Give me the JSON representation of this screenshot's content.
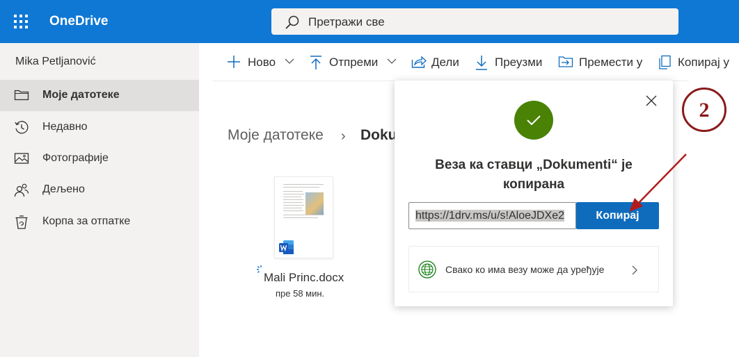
{
  "app": {
    "name": "OneDrive",
    "search_placeholder": "Претражи све"
  },
  "sidebar": {
    "user": "Mika Petljanović",
    "items": [
      {
        "label": "Моје датотеке",
        "icon": "folder-icon",
        "active": true
      },
      {
        "label": "Недавно",
        "icon": "clock-icon",
        "active": false
      },
      {
        "label": "Фотографије",
        "icon": "photo-icon",
        "active": false
      },
      {
        "label": "Дељено",
        "icon": "people-icon",
        "active": false
      },
      {
        "label": "Корпа за отпатке",
        "icon": "recycle-bin-icon",
        "active": false
      }
    ]
  },
  "commands": {
    "new": "Ново",
    "upload": "Отпреми",
    "share": "Дели",
    "download": "Преузми",
    "move": "Премести у",
    "copy": "Копирај у"
  },
  "breadcrumb": {
    "root": "Моје датотеке",
    "current": "Dokumenti"
  },
  "file": {
    "name": "Mali Princ.docx",
    "modified": "пре 58 мин."
  },
  "dialog": {
    "title": "Веза ка ставци „Dokumenti“ је копирана",
    "link": "https://1drv.ms/u/s!AloeJDXe2",
    "copy_button": "Копирај",
    "permission": "Свако ко има везу може да уређује",
    "colors": {
      "success": "#498205",
      "primary": "#0f6cbd"
    }
  },
  "annotation": {
    "step": "2",
    "color": "#8b1a1a"
  }
}
